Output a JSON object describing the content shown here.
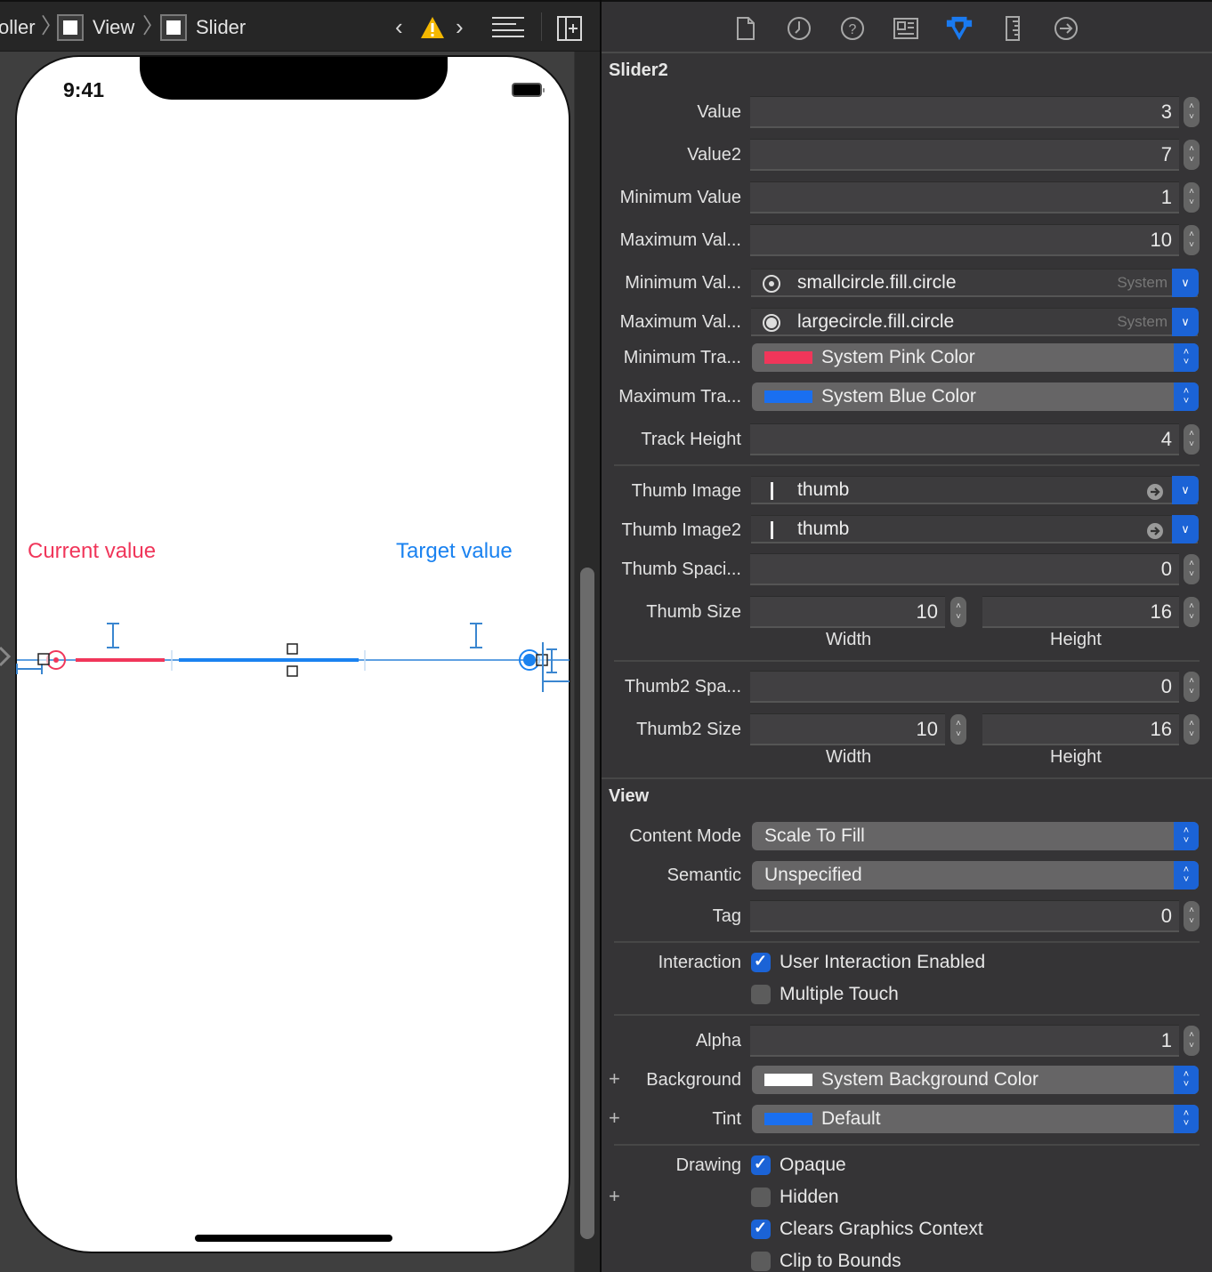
{
  "jumpbar": {
    "crumbs": [
      "oller",
      "View",
      "Slider"
    ],
    "warning_icon": "warning-triangle-icon",
    "nav_prev_icon": "chevron-left-icon",
    "nav_next_icon": "chevron-right-icon",
    "editor_options_icon": "lines-icon",
    "add_editor_icon": "split-add-icon"
  },
  "device": {
    "status_time": "9:41",
    "labels": {
      "current": "Current value",
      "target": "Target value"
    },
    "slider": {
      "value": 3,
      "value2": 7,
      "min": 1,
      "max": 10,
      "min_track_color": "#f0365a",
      "max_track_color": "#1a82f0"
    }
  },
  "inspector": {
    "tabs": [
      {
        "name": "file-inspector-icon",
        "active": false
      },
      {
        "name": "history-inspector-icon",
        "active": false
      },
      {
        "name": "help-inspector-icon",
        "active": false
      },
      {
        "name": "identity-inspector-icon",
        "active": false
      },
      {
        "name": "attributes-inspector-icon",
        "active": true
      },
      {
        "name": "size-inspector-icon",
        "active": false
      },
      {
        "name": "connections-inspector-icon",
        "active": false
      }
    ],
    "section1_title": "Slider2",
    "value": {
      "label": "Value",
      "value": "3"
    },
    "value2": {
      "label": "Value2",
      "value": "7"
    },
    "min_value": {
      "label": "Minimum Value",
      "value": "1"
    },
    "max_value": {
      "label": "Maximum Val...",
      "value": "10"
    },
    "min_image": {
      "label": "Minimum Val...",
      "value": "smallcircle.fill.circle",
      "source": "System"
    },
    "max_image": {
      "label": "Maximum Val...",
      "value": "largecircle.fill.circle",
      "source": "System"
    },
    "min_track": {
      "label": "Minimum Tra...",
      "value": "System Pink Color",
      "color": "#f0365a"
    },
    "max_track": {
      "label": "Maximum Tra...",
      "value": "System Blue Color",
      "color": "#1a6ff0"
    },
    "track_height": {
      "label": "Track Height",
      "value": "4"
    },
    "thumb_image": {
      "label": "Thumb Image",
      "value": "thumb"
    },
    "thumb_image2": {
      "label": "Thumb Image2",
      "value": "thumb"
    },
    "thumb_spacing": {
      "label": "Thumb Spaci...",
      "value": "0"
    },
    "thumb_size": {
      "label": "Thumb Size",
      "width": "10",
      "height": "16",
      "width_label": "Width",
      "height_label": "Height"
    },
    "thumb2_spacing": {
      "label": "Thumb2 Spa...",
      "value": "0"
    },
    "thumb2_size": {
      "label": "Thumb2 Size",
      "width": "10",
      "height": "16",
      "width_label": "Width",
      "height_label": "Height"
    },
    "section2_title": "View",
    "content_mode": {
      "label": "Content Mode",
      "value": "Scale To Fill"
    },
    "semantic": {
      "label": "Semantic",
      "value": "Unspecified"
    },
    "tag": {
      "label": "Tag",
      "value": "0"
    },
    "interaction": {
      "label": "Interaction",
      "options": [
        {
          "label": "User Interaction Enabled",
          "checked": true
        },
        {
          "label": "Multiple Touch",
          "checked": false
        }
      ]
    },
    "alpha": {
      "label": "Alpha",
      "value": "1"
    },
    "background": {
      "label": "Background",
      "value": "System Background Color",
      "color": "#ffffff"
    },
    "tint": {
      "label": "Tint",
      "value": "Default",
      "color": "#1a6ff0"
    },
    "drawing": {
      "label": "Drawing",
      "options": [
        {
          "label": "Opaque",
          "checked": true
        },
        {
          "label": "Hidden",
          "checked": false
        },
        {
          "label": "Clears Graphics Context",
          "checked": true
        },
        {
          "label": "Clip to Bounds",
          "checked": false
        }
      ]
    }
  }
}
